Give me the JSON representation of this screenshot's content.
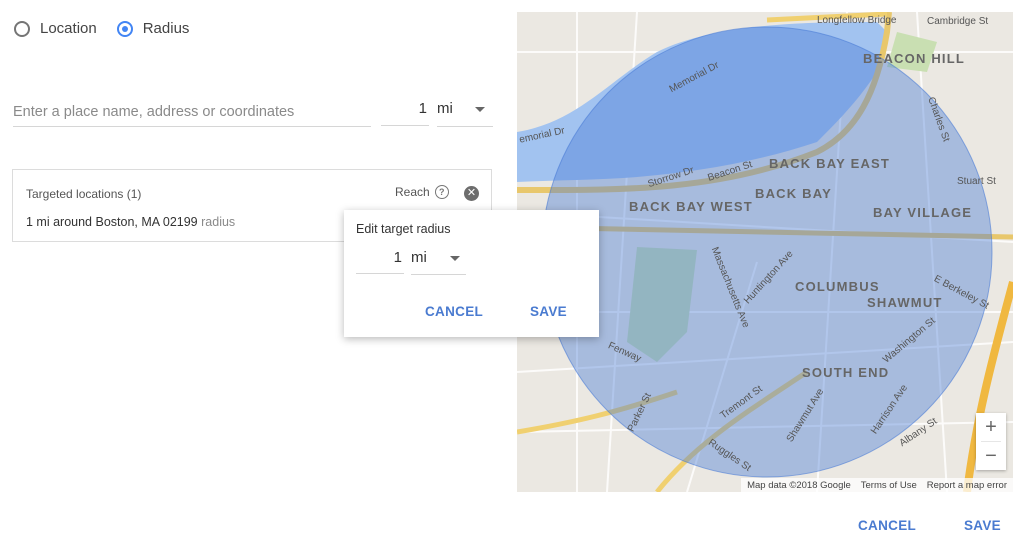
{
  "radio_options": {
    "location": {
      "label": "Location",
      "selected": false
    },
    "radius": {
      "label": "Radius",
      "selected": true
    }
  },
  "place_search": {
    "placeholder": "Enter a place name, address or coordinates",
    "radius_value": "1",
    "radius_unit": "mi"
  },
  "targeted": {
    "header": "Targeted locations (1)",
    "reach_label": "Reach",
    "location_text": "1 mi around Boston, MA 02199",
    "location_tag": "radius"
  },
  "popup": {
    "title": "Edit target radius",
    "radius_value": "1",
    "radius_unit": "mi",
    "cancel_label": "CANCEL",
    "save_label": "SAVE"
  },
  "map": {
    "labels": {
      "beacon_hill": "BEACON HILL",
      "back_bay_east": "BACK BAY EAST",
      "back_bay": "BACK BAY",
      "back_bay_west": "BACK BAY WEST",
      "bay_village": "BAY VILLAGE",
      "columbus": "COLUMBUS",
      "shawmut": "SHAWMUT",
      "south_end": "SOUTH END",
      "longfellow": "Longfellow Bridge",
      "cambridge_st": "Cambridge St",
      "memorial_dr": "Memorial Dr",
      "emorial_dr": "emorial Dr",
      "storrow_dr": "Storrow Dr",
      "beacon_st": "Beacon St",
      "charles_st": "Charles St",
      "stuart_st": "Stuart St",
      "mass_ave": "Massachusetts Ave",
      "huntington": "Huntington Ave",
      "tremont": "Tremont St",
      "fenway": "Fenway",
      "washington": "Washington St",
      "e_berkeley": "E Berkeley St",
      "albany": "Albany St",
      "harrison": "Harrison Ave",
      "shawmut_ave": "Shawmut Ave",
      "parker": "Parker St",
      "ruggles": "Ruggles St"
    },
    "attribution": {
      "data": "Map data ©2018 Google",
      "terms": "Terms of Use",
      "report": "Report a map error"
    },
    "zoom_in": "+",
    "zoom_out": "−"
  },
  "footer": {
    "cancel_label": "CANCEL",
    "save_label": "SAVE"
  },
  "colors": {
    "accent": "#4285f4",
    "button_text": "#4a7bd0",
    "radius_fill": "#4a7cd6"
  }
}
